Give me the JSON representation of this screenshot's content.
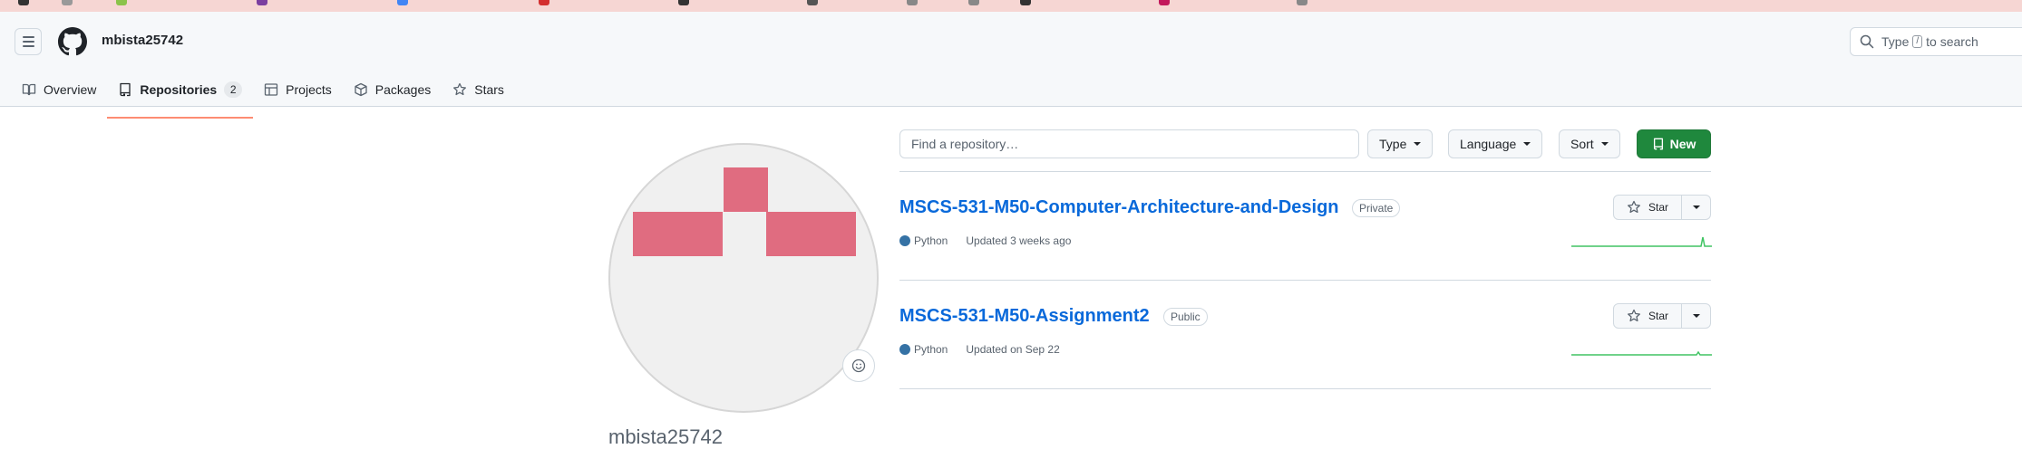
{
  "header": {
    "username": "mbista25742",
    "search": {
      "prefix": "Type",
      "key": "/",
      "suffix": "to search"
    }
  },
  "tabs": [
    {
      "label": "Overview",
      "icon": "book-icon"
    },
    {
      "label": "Repositories",
      "icon": "repo-icon",
      "count": "2",
      "selected": true
    },
    {
      "label": "Projects",
      "icon": "table-icon"
    },
    {
      "label": "Packages",
      "icon": "package-icon"
    },
    {
      "label": "Stars",
      "icon": "star-icon"
    }
  ],
  "profile": {
    "name": "mbista25742"
  },
  "toolbar": {
    "find_placeholder": "Find a repository…",
    "type_label": "Type",
    "language_label": "Language",
    "sort_label": "Sort",
    "new_label": "New"
  },
  "repos": [
    {
      "name": "MSCS-531-M50-Computer-Architecture-and-Design",
      "visibility": "Private",
      "language": "Python",
      "language_color": "#3572A5",
      "updated": "Updated 3 weeks ago",
      "star_label": "Star"
    },
    {
      "name": "MSCS-531-M50-Assignment2",
      "visibility": "Public",
      "language": "Python",
      "language_color": "#3572A5",
      "updated": "Updated on Sep 22",
      "star_label": "Star"
    }
  ],
  "colors": {
    "accent": "#0969da",
    "primary_button": "#1f883d",
    "tab_underline": "#fd8c73",
    "avatar_pixels": "#e06c80",
    "sparkline": "#40c463",
    "browser_strip": "#f6d6d3"
  }
}
